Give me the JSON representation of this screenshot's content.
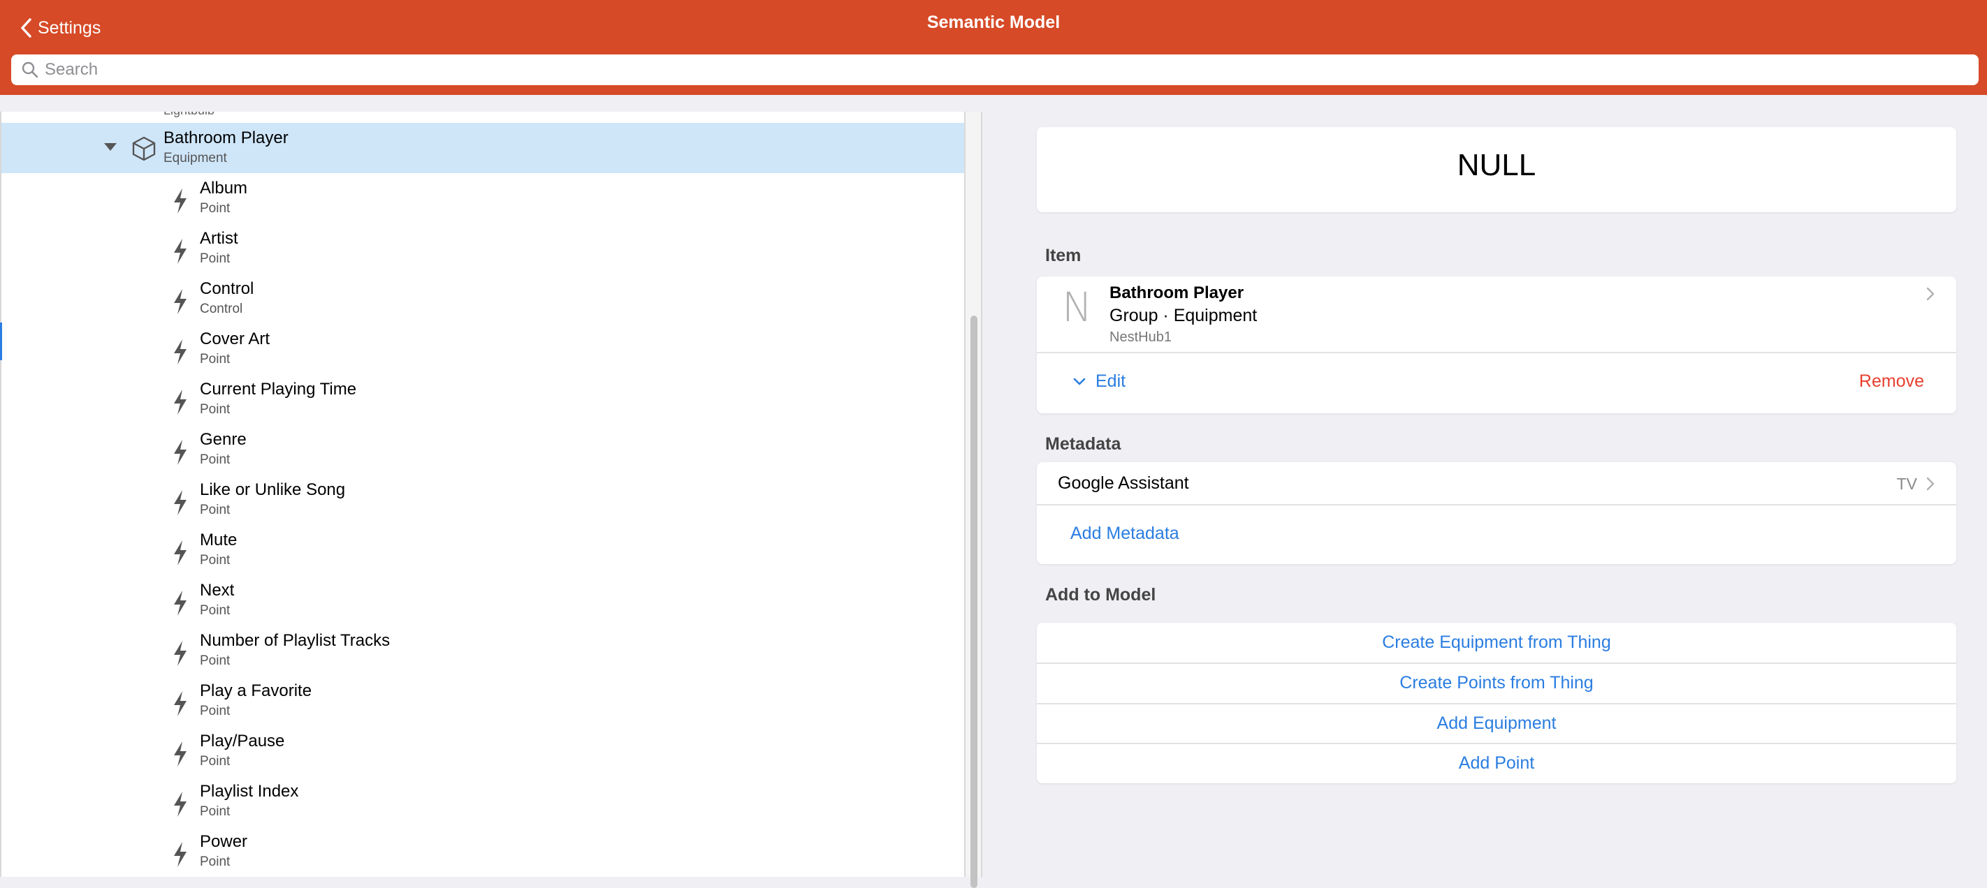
{
  "nav": {
    "back_label": "Settings",
    "title": "Semantic Model",
    "search_placeholder": "Search"
  },
  "tree": {
    "clipped_item_sub": "Lightbulb",
    "selected": {
      "title": "Bathroom Player",
      "sub": "Equipment"
    },
    "points": [
      {
        "title": "Album",
        "sub": "Point"
      },
      {
        "title": "Artist",
        "sub": "Point"
      },
      {
        "title": "Control",
        "sub": "Control"
      },
      {
        "title": "Cover Art",
        "sub": "Point"
      },
      {
        "title": "Current Playing Time",
        "sub": "Point"
      },
      {
        "title": "Genre",
        "sub": "Point"
      },
      {
        "title": "Like or Unlike Song",
        "sub": "Point"
      },
      {
        "title": "Mute",
        "sub": "Point"
      },
      {
        "title": "Next",
        "sub": "Point"
      },
      {
        "title": "Number of Playlist Tracks",
        "sub": "Point"
      },
      {
        "title": "Play a Favorite",
        "sub": "Point"
      },
      {
        "title": "Play/Pause",
        "sub": "Point"
      },
      {
        "title": "Playlist Index",
        "sub": "Point"
      },
      {
        "title": "Power",
        "sub": "Point"
      }
    ]
  },
  "state": {
    "value": "NULL"
  },
  "item_section": {
    "label": "Item",
    "letter": "N",
    "name": "Bathroom Player",
    "type": "Group · Equipment",
    "id": "NestHub1",
    "edit_label": "Edit",
    "remove_label": "Remove"
  },
  "metadata_section": {
    "label": "Metadata",
    "rows": [
      {
        "name": "Google Assistant",
        "value": "TV"
      }
    ],
    "add_label": "Add Metadata"
  },
  "model_section": {
    "label": "Add to Model",
    "buttons": [
      "Create Equipment from Thing",
      "Create Points from Thing",
      "Add Equipment",
      "Add Point"
    ]
  },
  "colors": {
    "header": "#d64a27",
    "accent": "#2a7de1",
    "destructive": "#e7402f",
    "selected_row": "#cfe6f9"
  }
}
